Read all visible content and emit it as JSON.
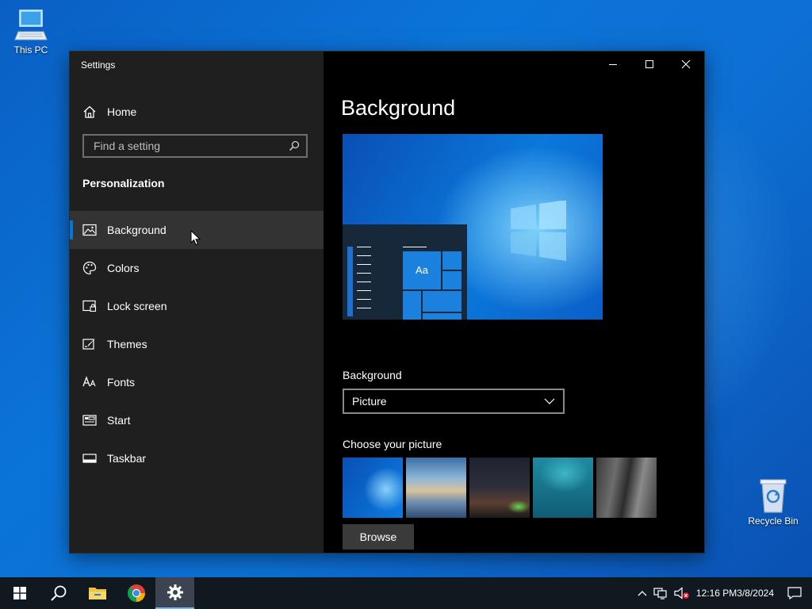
{
  "desktop": {
    "this_pc": "This PC",
    "recycle_bin": "Recycle Bin"
  },
  "window": {
    "title": "Settings",
    "home": "Home",
    "search_placeholder": "Find a setting",
    "section": "Personalization",
    "nav": [
      {
        "label": "Background",
        "icon": "picture-icon",
        "active": true
      },
      {
        "label": "Colors",
        "icon": "palette-icon"
      },
      {
        "label": "Lock screen",
        "icon": "lock-screen-icon"
      },
      {
        "label": "Themes",
        "icon": "themes-brush-icon"
      },
      {
        "label": "Fonts",
        "icon": "fonts-icon"
      },
      {
        "label": "Start",
        "icon": "start-icon"
      },
      {
        "label": "Taskbar",
        "icon": "taskbar-icon"
      }
    ],
    "page_title": "Background",
    "preview_tile_text": "Aa",
    "background_label": "Background",
    "background_value": "Picture",
    "choose_label": "Choose your picture",
    "browse": "Browse"
  },
  "taskbar": {
    "time": "12:16 PM",
    "date": "3/8/2024"
  },
  "colors": {
    "accent": "#0078d7",
    "sidebar": "#1f1f1f",
    "content": "#000000",
    "taskbar": "#101820"
  }
}
